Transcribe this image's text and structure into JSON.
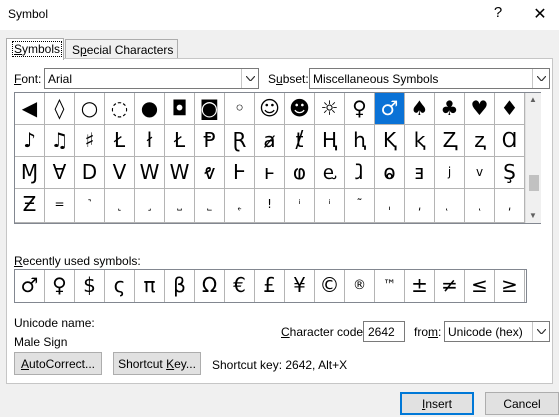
{
  "window": {
    "title": "Symbol",
    "help_label": "?",
    "close_label": "✕"
  },
  "tabs": [
    {
      "label_u": "S",
      "label_rest": "ymbols"
    },
    {
      "label_pre": "S",
      "label_u": "p",
      "label_rest": "ecial Characters"
    }
  ],
  "font": {
    "label_u": "F",
    "label_rest": "ont:",
    "value": "Arial"
  },
  "subset": {
    "label_u": "u",
    "label_pre": "S",
    "label_rest": "bset:",
    "value": "Miscellaneous Symbols"
  },
  "symbols": [
    [
      "◀",
      "◊",
      "○",
      "◌",
      "●",
      "◘",
      "◙",
      "◦",
      "☺",
      "☻",
      "☼",
      "♀",
      "♂",
      "♠",
      "♣",
      "♥",
      "♦"
    ],
    [
      "♪",
      "♫",
      "♯",
      "Ł",
      "ł",
      "Ł",
      "Ᵽ",
      "Ɽ",
      "ⱥ",
      "ⱦ",
      "Ⱨ",
      "ⱨ",
      "Ⱪ",
      "ⱪ",
      "Ⱬ",
      "ⱬ",
      "Ɑ"
    ],
    [
      "Ɱ",
      "Ɐ",
      "D",
      "V",
      "W",
      "W",
      "ⱴ",
      "Ⱶ",
      "ⱶ",
      "ⱷ",
      "ⱸ",
      "ⱹ",
      "ⱺ",
      "ⱻ",
      "j",
      "v",
      "Ş"
    ],
    [
      "Ƶ",
      "=",
      "˺",
      "˻",
      "˼",
      "˽",
      "˾",
      "˿",
      "!",
      "ⁱ",
      "ⁱ",
      "˜",
      "ˌ",
      "͵",
      "ͅ",
      "ͺ",
      "͵"
    ]
  ],
  "symbols_small": [
    [
      false,
      false,
      false,
      false,
      false,
      false,
      false,
      false,
      false,
      false,
      false,
      false,
      false,
      false,
      false,
      false,
      false
    ],
    [
      false,
      false,
      false,
      false,
      false,
      false,
      false,
      false,
      false,
      false,
      false,
      false,
      false,
      false,
      false,
      false,
      false
    ],
    [
      false,
      false,
      false,
      false,
      false,
      false,
      false,
      false,
      false,
      false,
      false,
      false,
      false,
      false,
      true,
      true,
      false
    ],
    [
      false,
      true,
      true,
      true,
      true,
      true,
      true,
      true,
      true,
      true,
      true,
      true,
      true,
      true,
      true,
      true,
      true
    ]
  ],
  "selected_symbol": {
    "row": 0,
    "col": 12
  },
  "recent": {
    "label_u": "R",
    "label_rest": "ecently used symbols:",
    "items": [
      "♂",
      "♀",
      "$",
      "ς",
      "π",
      "β",
      "Ω",
      "€",
      "£",
      "¥",
      "©",
      "®",
      "™",
      "±",
      "≠",
      "≤",
      "≥"
    ]
  },
  "unicode_name": {
    "label": "Unicode name:",
    "value": "Male Sign"
  },
  "char_code": {
    "label_u": "C",
    "label_rest": "haracter code:",
    "value": "2642"
  },
  "from": {
    "label_u": "m",
    "label_pre": "fro",
    "label_rest": ":",
    "value": "Unicode (hex)"
  },
  "buttons": {
    "autocorrect": {
      "label_u": "A",
      "label_rest": "utoCorrect..."
    },
    "shortcut": {
      "label_pre": "Shortcut ",
      "label_u": "K",
      "label_rest": "ey..."
    },
    "shortcut_key_text": "Shortcut key: 2642, Alt+X",
    "insert": {
      "label_u": "I",
      "label_rest": "nsert"
    },
    "cancel": {
      "label": "Cancel"
    }
  }
}
